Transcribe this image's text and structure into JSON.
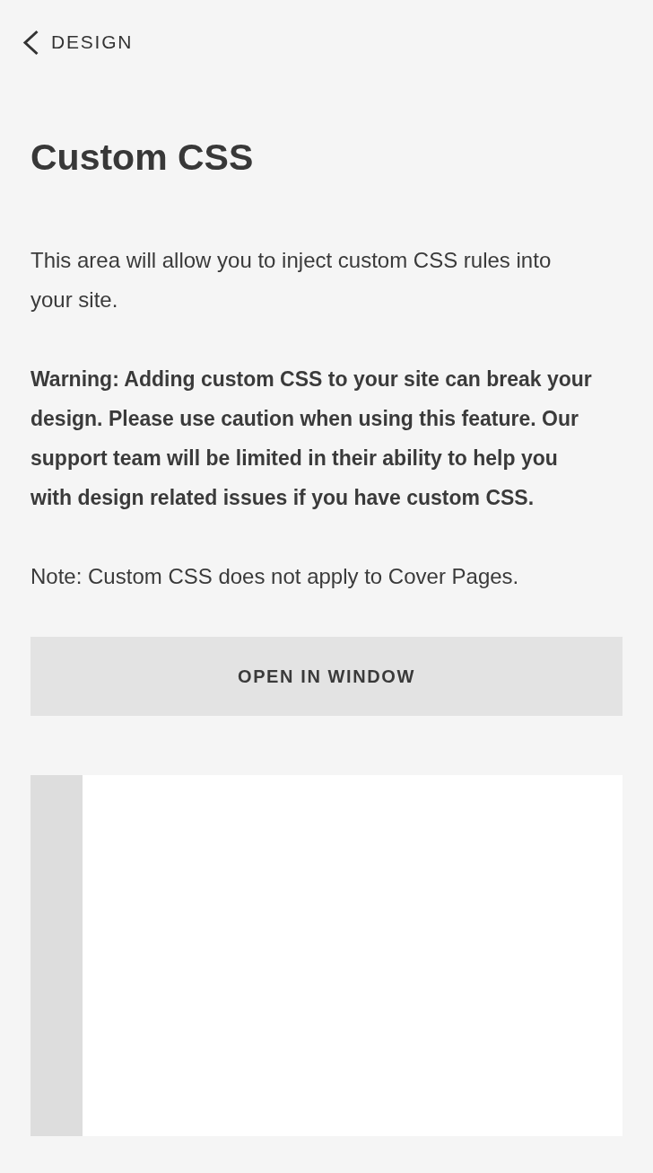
{
  "back_link": {
    "label": "DESIGN"
  },
  "title": "Custom CSS",
  "paragraphs": [
    {
      "kind": "normal",
      "text": "This area will allow you to inject custom CSS rules into your site."
    },
    {
      "kind": "warning",
      "text": "Warning: Adding custom CSS to your site can break your design. Please use caution when using this feature. Our support team will be limited in their ability to help you with design related issues if you have custom CSS."
    },
    {
      "kind": "normal",
      "text": "Note: Custom CSS does not apply to Cover Pages."
    }
  ],
  "open_button": {
    "label": "OPEN IN WINDOW"
  }
}
